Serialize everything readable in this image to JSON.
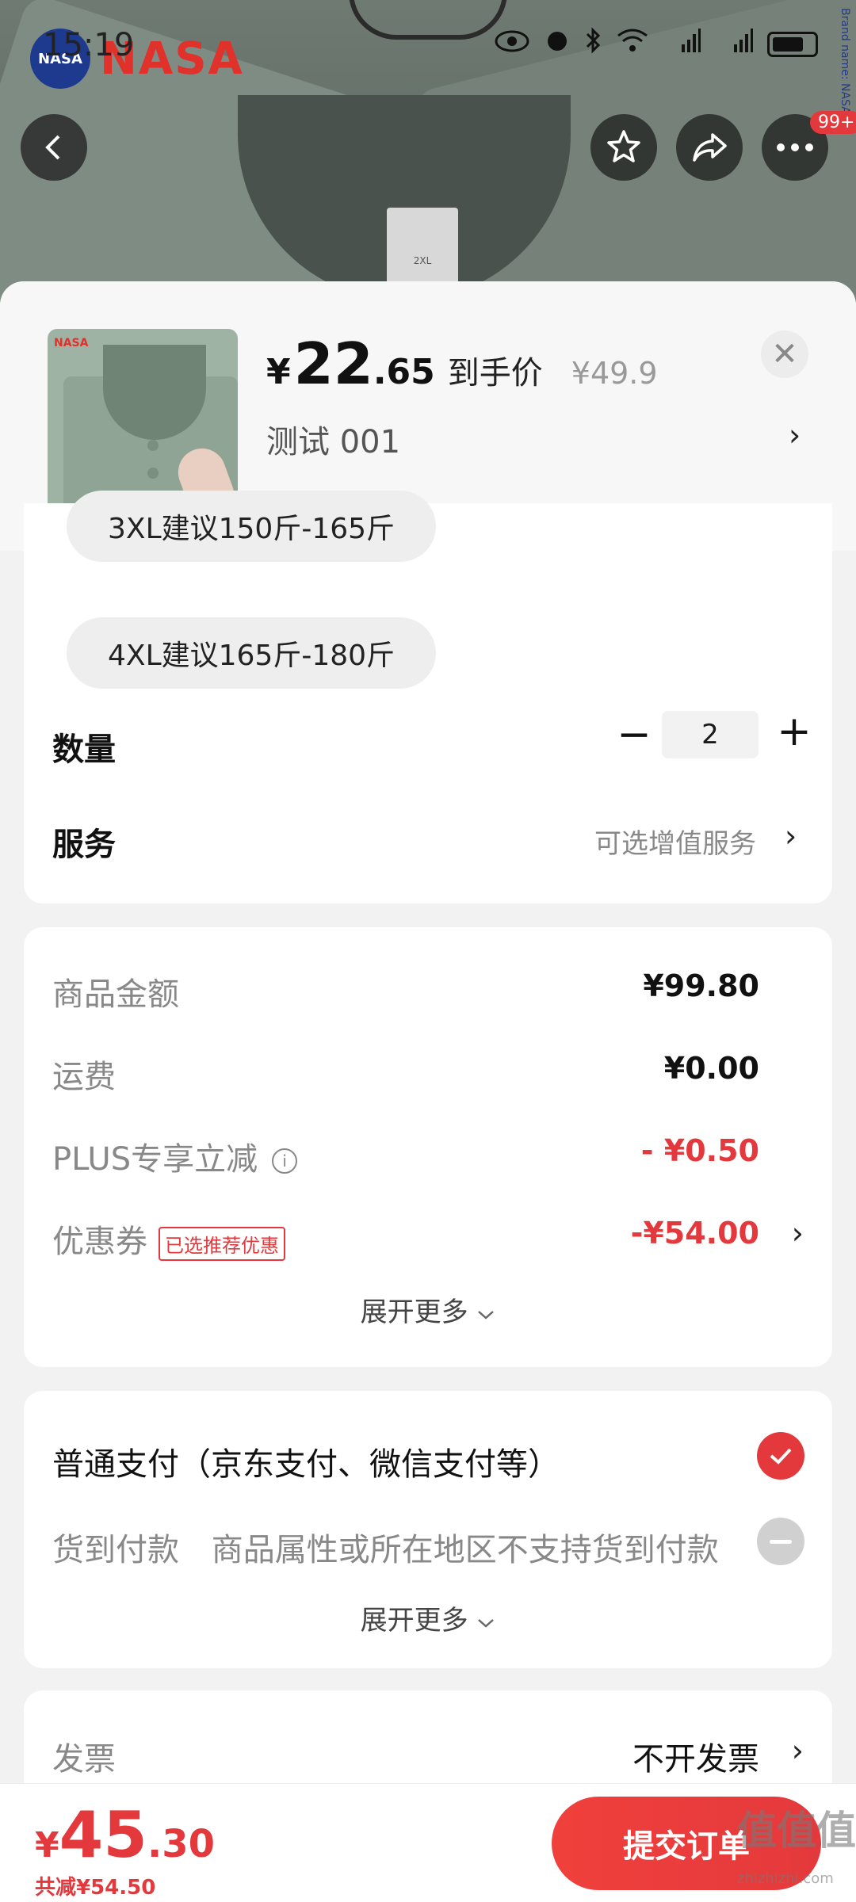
{
  "status_bar": {
    "time": "15:19",
    "brand_logo_text": "NASA",
    "brand_badge_text": "NASA"
  },
  "nav": {
    "badge": "99+"
  },
  "background": {
    "side_text": "Brand name: NASA",
    "tag_text": "2XL"
  },
  "product": {
    "price_symbol": "¥",
    "price_int": "22",
    "price_dec": ".65",
    "price_label": "到手价",
    "orig_price": "¥49.9",
    "variant": "测试  001",
    "thumb_logo": "NASA"
  },
  "sizes": [
    {
      "label": "3XL建议150斤-165斤"
    },
    {
      "label": "4XL建议165斤-180斤"
    }
  ],
  "quantity": {
    "label": "数量",
    "value": "2",
    "minus": "−",
    "plus": "+"
  },
  "service": {
    "label": "服务",
    "value": "可选增值服务"
  },
  "amounts": {
    "goods_label": "商品金额",
    "goods_value": "¥99.80",
    "freight_label": "运费",
    "freight_value": "¥0.00",
    "plus_label": "PLUS专享立减",
    "plus_value": "- ¥0.50",
    "coupon_label": "优惠券",
    "coupon_tag": "已选推荐优惠",
    "coupon_value": "-¥54.00",
    "expand": "展开更多"
  },
  "payment": {
    "normal": "普通支付（京东支付、微信支付等）",
    "cod_label": "货到付款",
    "cod_note": "商品属性或所在地区不支持货到付款",
    "expand": "展开更多"
  },
  "invoice": {
    "label": "发票",
    "value": "不开发票"
  },
  "bottom": {
    "total_symbol": "¥",
    "total_int": "45",
    "total_dec": ".30",
    "saved": "共减¥54.50",
    "submit": "提交订单",
    "watermark": "值值值",
    "watermark_sub": "zhizhizhi.com"
  },
  "colors": {
    "accent": "#e4393c",
    "background": "#f2f2f2"
  }
}
